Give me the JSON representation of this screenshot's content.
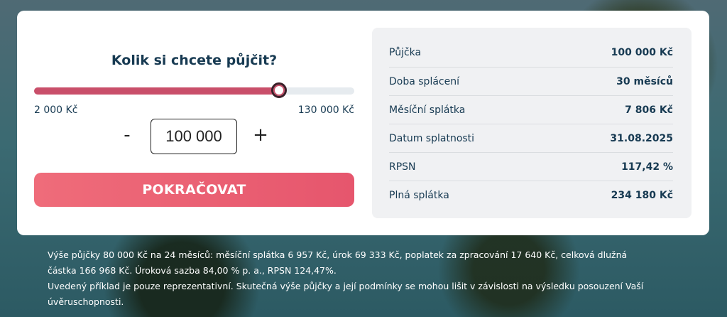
{
  "calculator": {
    "title": "Kolik si chcete půjčit?",
    "slider": {
      "min_label": "2 000 Kč",
      "max_label": "130 000 Kč",
      "min": 2000,
      "max": 130000,
      "value": 100000
    },
    "minus_label": "-",
    "plus_label": "+",
    "amount_value": "100 000",
    "continue_label": "POKRAČOVAT"
  },
  "summary": {
    "rows": [
      {
        "label": "Půjčka",
        "value": "100 000 Kč"
      },
      {
        "label": "Doba splácení",
        "value": "30 měsíců"
      },
      {
        "label": "Měsíční splátka",
        "value": "7 806 Kč"
      },
      {
        "label": "Datum splatnosti",
        "value": "31.08.2025"
      },
      {
        "label": "RPSN",
        "value": "117,42 %"
      },
      {
        "label": "Plná splátka",
        "value": "234 180 Kč"
      }
    ]
  },
  "disclaimer": {
    "line1": "Výše půjčky 80 000 Kč na 24 měsíců: měsíční splátka 6 957 Kč, úrok 69 333 Kč, poplatek za zpracování 17 640 Kč, celková dlužná",
    "line2": "částka 166 968 Kč. Úroková sazba 84,00 % p. a., RPSN  124,47%.",
    "line3": "Uvedený příklad je pouze reprezentativní. Skutečná výše půjčky a její podmínky se mohou lišit v závislosti na výsledku posouzení Vaší",
    "line4": "úvěruschopnosti."
  },
  "colors": {
    "accent": "#c94f6a",
    "button": "#e6566d",
    "heading": "#173a52"
  }
}
